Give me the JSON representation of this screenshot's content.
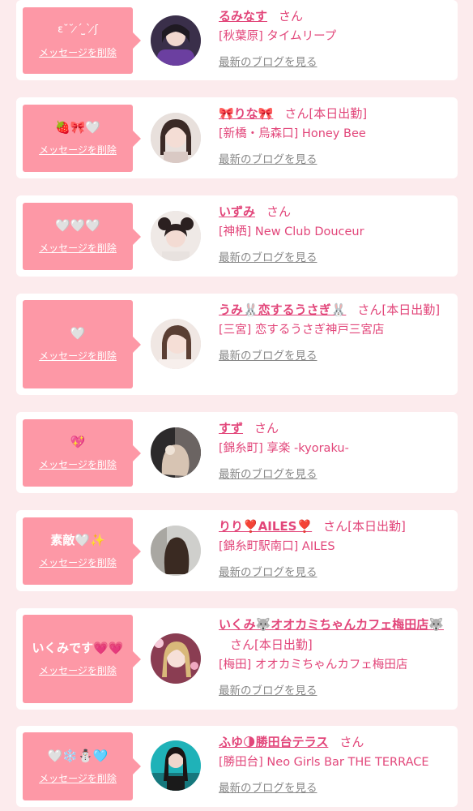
{
  "common": {
    "delete_label": "メッセージを削除",
    "blog_label": "最新のブログを見る",
    "san_suffix": "さん"
  },
  "messages": [
    {
      "bubble_text": "ε˘˘ ̷ˊ ̫ˋ ̷ʃ",
      "name": "るみなす",
      "status": "",
      "shop": "[秋葉原] タイムリープ"
    },
    {
      "bubble_text": "🍓🎀🤍",
      "name": "🎀りな🎀",
      "status": "[本日出勤]",
      "shop": "[新橋・烏森口] Honey Bee"
    },
    {
      "bubble_text": "🤍🤍🤍",
      "name": "いずみ",
      "status": "",
      "shop": "[神栖] New Club Douceur"
    },
    {
      "bubble_text": "🤍",
      "name": "うみ🐰恋するうさぎ🐰",
      "status": "[本日出勤]",
      "shop": "[三宮] 恋するうさぎ神戸三宮店"
    },
    {
      "bubble_text": "💖",
      "name": "すず",
      "status": "",
      "shop": "[錦糸町] 享楽 -kyoraku-"
    },
    {
      "bubble_text": "素敵🤍✨",
      "name": "りり❣️AILES❣️",
      "status": "[本日出勤]",
      "shop": "[錦糸町駅南口] AILES"
    },
    {
      "bubble_text": "いくみです💗💗",
      "name": "いくみ🐺オオカミちゃんカフェ梅田店🐺",
      "status": "[本日出勤]",
      "shop": "[梅田] オオカミちゃんカフェ梅田店"
    },
    {
      "bubble_text": "🤍❄️⛄️🩵",
      "name": "ふゆ🌗勝田台テラス",
      "status": "",
      "shop": "[勝田台] Neo Girls Bar THE TERRACE"
    }
  ],
  "colors": {
    "background": "#fcebed",
    "bubble": "#fd98a6",
    "accent": "#e2467a",
    "muted_link": "#888888"
  }
}
